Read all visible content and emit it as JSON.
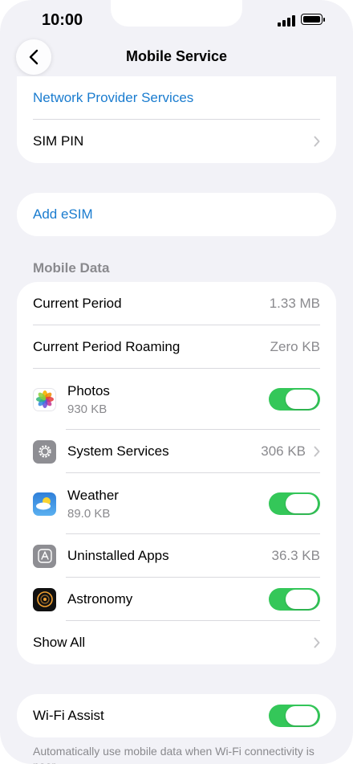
{
  "status_bar": {
    "time": "10:00"
  },
  "nav": {
    "title": "Mobile Service"
  },
  "group_top": {
    "network_provider_services": "Network Provider Services",
    "sim_pin": "SIM PIN"
  },
  "add_esim": {
    "label": "Add eSIM"
  },
  "mobile_data": {
    "header": "Mobile Data",
    "current_period": {
      "label": "Current Period",
      "value": "1.33 MB"
    },
    "current_period_roaming": {
      "label": "Current Period Roaming",
      "value": "Zero KB"
    },
    "apps": [
      {
        "name": "Photos",
        "usage": "930 KB",
        "enabled": true,
        "icon": "photos-icon"
      },
      {
        "name": "System Services",
        "usage": "306 KB",
        "icon": "gear-icon"
      },
      {
        "name": "Weather",
        "usage": "89.0 KB",
        "enabled": true,
        "icon": "weather-icon"
      },
      {
        "name": "Uninstalled Apps",
        "usage": "36.3 KB",
        "icon": "app-store-icon"
      },
      {
        "name": "Astronomy",
        "enabled": true,
        "icon": "astronomy-icon"
      }
    ],
    "show_all": "Show All"
  },
  "wifi_assist": {
    "label": "Wi-Fi Assist",
    "enabled": true,
    "footnote": "Automatically use mobile data when Wi-Fi connectivity is poor."
  },
  "colors": {
    "accent": "#1a7ccf",
    "toggle_on": "#34c759",
    "background": "#f2f2f7"
  }
}
